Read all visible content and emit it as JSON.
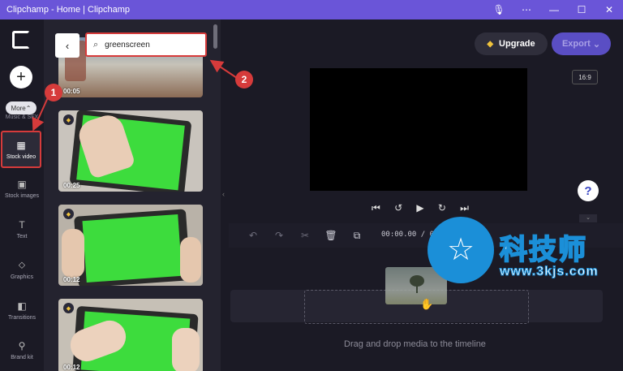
{
  "window": {
    "title": "Clipchamp - Home | Clipchamp"
  },
  "rail": {
    "more_label": "More",
    "music_label": "Music & SFX",
    "items": [
      {
        "label": "Stock video",
        "icon": "film-icon"
      },
      {
        "label": "Stock images",
        "icon": "image-icon"
      },
      {
        "label": "Text",
        "icon": "text-icon"
      },
      {
        "label": "Graphics",
        "icon": "shapes-icon"
      },
      {
        "label": "Transitions",
        "icon": "transitions-icon"
      },
      {
        "label": "Brand kit",
        "icon": "brand-kit-icon"
      }
    ]
  },
  "search": {
    "value": "greenscreen"
  },
  "thumbs": [
    {
      "duration": "00:05"
    },
    {
      "duration": "00:25"
    },
    {
      "duration": "00:12"
    },
    {
      "duration": "00:12"
    }
  ],
  "header": {
    "upgrade_label": "Upgrade",
    "export_label": "Export"
  },
  "preview": {
    "aspect_ratio": "16:9"
  },
  "timeline": {
    "timecode": "00:00.00 / 0",
    "drop_text": "Drag and drop media to the timeline"
  },
  "annotations": {
    "one": "1",
    "two": "2"
  },
  "watermark": {
    "title": "科技师",
    "url": "www.3kjs.com"
  },
  "colors": {
    "accent": "#6a55d8",
    "annotation_red": "#d63b3b",
    "watermark_blue": "#1b8fd8",
    "green_screen": "#3ddc3d"
  }
}
